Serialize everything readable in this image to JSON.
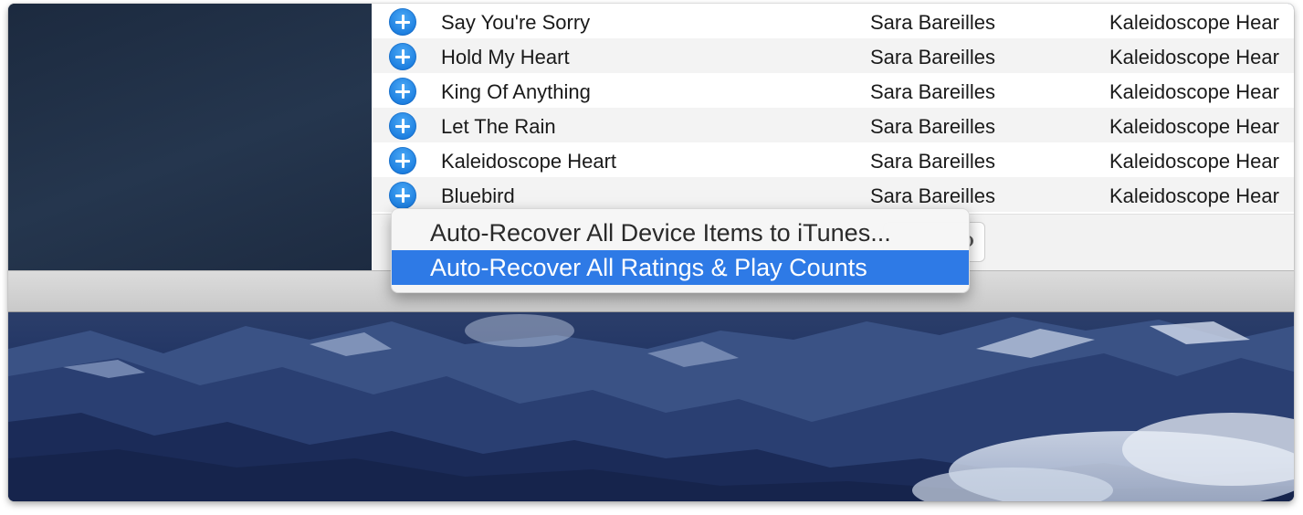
{
  "songs": [
    {
      "name": "Say You're Sorry",
      "artist": "Sara Bareilles",
      "album": "Kaleidoscope Hear"
    },
    {
      "name": "Hold My Heart",
      "artist": "Sara Bareilles",
      "album": "Kaleidoscope Hear"
    },
    {
      "name": "King Of Anything",
      "artist": "Sara Bareilles",
      "album": "Kaleidoscope Hear"
    },
    {
      "name": "Let The Rain",
      "artist": "Sara Bareilles",
      "album": "Kaleidoscope Hear"
    },
    {
      "name": "Kaleidoscope Heart",
      "artist": "Sara Bareilles",
      "album": "Kaleidoscope Hear"
    },
    {
      "name": "Bluebird",
      "artist": "Sara Bareilles",
      "album": "Kaleidoscope Hear"
    }
  ],
  "menu": {
    "items": [
      {
        "label": "Auto-Recover All Device Items to iTunes...",
        "highlighted": false
      },
      {
        "label": "Auto-Recover All Ratings & Play Counts",
        "highlighted": true
      }
    ]
  },
  "icons": {
    "add": "add-circle-icon"
  },
  "colors": {
    "accent": "#2e7ae6",
    "add_icon": "#1d7fe0",
    "row_alt": "#f3f3f3"
  }
}
